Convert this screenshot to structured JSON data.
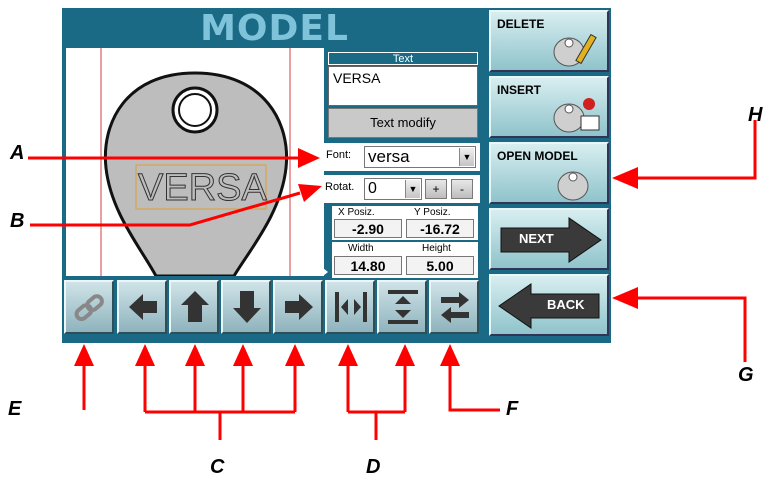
{
  "title": "MODEL",
  "text_panel": {
    "header": "Text",
    "text_value": "VERSA",
    "modify_button": "Text modify",
    "font_label": "Font:",
    "font_value": "versa",
    "rotation_label": "Rotat.",
    "rotation_value": "0",
    "plus_label": "+",
    "minus_label": "-",
    "xpos_label": "X Posiz.",
    "ypos_label": "Y Posiz.",
    "xpos_value": "-2.90",
    "ypos_value": "-16.72",
    "width_label": "Width",
    "height_label": "Height",
    "width_value": "14.80",
    "height_value": "5.00"
  },
  "canvas": {
    "key_text": "VERSA"
  },
  "side_buttons": {
    "delete": "DELETE",
    "insert": "INSERT",
    "open_model": "OPEN MODEL",
    "next": "NEXT",
    "back": "BACK"
  },
  "callouts": {
    "a": "A",
    "b": "B",
    "c": "C",
    "d": "D",
    "e": "E",
    "f": "F",
    "g": "G",
    "h": "H"
  },
  "colors": {
    "panel": "#1a6a85",
    "callout_arrow": "#ff0000",
    "title": "#7ec3da"
  },
  "icons": [
    "chain-icon",
    "arrow-left-icon",
    "arrow-up-icon",
    "arrow-down-icon",
    "arrow-right-icon",
    "stretch-horizontal-icon",
    "stretch-vertical-icon",
    "swap-icon"
  ]
}
